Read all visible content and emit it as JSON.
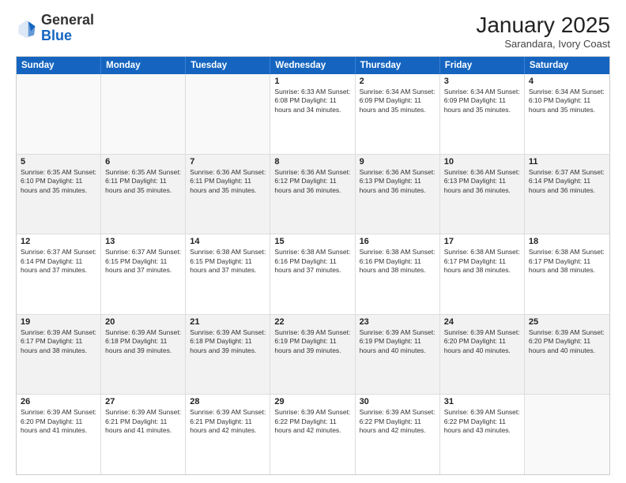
{
  "header": {
    "logo_general": "General",
    "logo_blue": "Blue",
    "month_title": "January 2025",
    "subtitle": "Sarandara, Ivory Coast"
  },
  "days_of_week": [
    "Sunday",
    "Monday",
    "Tuesday",
    "Wednesday",
    "Thursday",
    "Friday",
    "Saturday"
  ],
  "rows": [
    [
      {
        "day": "",
        "info": "",
        "empty": true
      },
      {
        "day": "",
        "info": "",
        "empty": true
      },
      {
        "day": "",
        "info": "",
        "empty": true
      },
      {
        "day": "1",
        "info": "Sunrise: 6:33 AM\nSunset: 6:08 PM\nDaylight: 11 hours and 34 minutes.",
        "empty": false
      },
      {
        "day": "2",
        "info": "Sunrise: 6:34 AM\nSunset: 6:09 PM\nDaylight: 11 hours and 35 minutes.",
        "empty": false
      },
      {
        "day": "3",
        "info": "Sunrise: 6:34 AM\nSunset: 6:09 PM\nDaylight: 11 hours and 35 minutes.",
        "empty": false
      },
      {
        "day": "4",
        "info": "Sunrise: 6:34 AM\nSunset: 6:10 PM\nDaylight: 11 hours and 35 minutes.",
        "empty": false
      }
    ],
    [
      {
        "day": "5",
        "info": "Sunrise: 6:35 AM\nSunset: 6:10 PM\nDaylight: 11 hours and 35 minutes.",
        "shade": true
      },
      {
        "day": "6",
        "info": "Sunrise: 6:35 AM\nSunset: 6:11 PM\nDaylight: 11 hours and 35 minutes.",
        "shade": true
      },
      {
        "day": "7",
        "info": "Sunrise: 6:36 AM\nSunset: 6:11 PM\nDaylight: 11 hours and 35 minutes.",
        "shade": true
      },
      {
        "day": "8",
        "info": "Sunrise: 6:36 AM\nSunset: 6:12 PM\nDaylight: 11 hours and 36 minutes.",
        "shade": true
      },
      {
        "day": "9",
        "info": "Sunrise: 6:36 AM\nSunset: 6:13 PM\nDaylight: 11 hours and 36 minutes.",
        "shade": true
      },
      {
        "day": "10",
        "info": "Sunrise: 6:36 AM\nSunset: 6:13 PM\nDaylight: 11 hours and 36 minutes.",
        "shade": true
      },
      {
        "day": "11",
        "info": "Sunrise: 6:37 AM\nSunset: 6:14 PM\nDaylight: 11 hours and 36 minutes.",
        "shade": true
      }
    ],
    [
      {
        "day": "12",
        "info": "Sunrise: 6:37 AM\nSunset: 6:14 PM\nDaylight: 11 hours and 37 minutes.",
        "empty": false
      },
      {
        "day": "13",
        "info": "Sunrise: 6:37 AM\nSunset: 6:15 PM\nDaylight: 11 hours and 37 minutes.",
        "empty": false
      },
      {
        "day": "14",
        "info": "Sunrise: 6:38 AM\nSunset: 6:15 PM\nDaylight: 11 hours and 37 minutes.",
        "empty": false
      },
      {
        "day": "15",
        "info": "Sunrise: 6:38 AM\nSunset: 6:16 PM\nDaylight: 11 hours and 37 minutes.",
        "empty": false
      },
      {
        "day": "16",
        "info": "Sunrise: 6:38 AM\nSunset: 6:16 PM\nDaylight: 11 hours and 38 minutes.",
        "empty": false
      },
      {
        "day": "17",
        "info": "Sunrise: 6:38 AM\nSunset: 6:17 PM\nDaylight: 11 hours and 38 minutes.",
        "empty": false
      },
      {
        "day": "18",
        "info": "Sunrise: 6:38 AM\nSunset: 6:17 PM\nDaylight: 11 hours and 38 minutes.",
        "empty": false
      }
    ],
    [
      {
        "day": "19",
        "info": "Sunrise: 6:39 AM\nSunset: 6:17 PM\nDaylight: 11 hours and 38 minutes.",
        "shade": true
      },
      {
        "day": "20",
        "info": "Sunrise: 6:39 AM\nSunset: 6:18 PM\nDaylight: 11 hours and 39 minutes.",
        "shade": true
      },
      {
        "day": "21",
        "info": "Sunrise: 6:39 AM\nSunset: 6:18 PM\nDaylight: 11 hours and 39 minutes.",
        "shade": true
      },
      {
        "day": "22",
        "info": "Sunrise: 6:39 AM\nSunset: 6:19 PM\nDaylight: 11 hours and 39 minutes.",
        "shade": true
      },
      {
        "day": "23",
        "info": "Sunrise: 6:39 AM\nSunset: 6:19 PM\nDaylight: 11 hours and 40 minutes.",
        "shade": true
      },
      {
        "day": "24",
        "info": "Sunrise: 6:39 AM\nSunset: 6:20 PM\nDaylight: 11 hours and 40 minutes.",
        "shade": true
      },
      {
        "day": "25",
        "info": "Sunrise: 6:39 AM\nSunset: 6:20 PM\nDaylight: 11 hours and 40 minutes.",
        "shade": true
      }
    ],
    [
      {
        "day": "26",
        "info": "Sunrise: 6:39 AM\nSunset: 6:20 PM\nDaylight: 11 hours and 41 minutes.",
        "empty": false
      },
      {
        "day": "27",
        "info": "Sunrise: 6:39 AM\nSunset: 6:21 PM\nDaylight: 11 hours and 41 minutes.",
        "empty": false
      },
      {
        "day": "28",
        "info": "Sunrise: 6:39 AM\nSunset: 6:21 PM\nDaylight: 11 hours and 42 minutes.",
        "empty": false
      },
      {
        "day": "29",
        "info": "Sunrise: 6:39 AM\nSunset: 6:22 PM\nDaylight: 11 hours and 42 minutes.",
        "empty": false
      },
      {
        "day": "30",
        "info": "Sunrise: 6:39 AM\nSunset: 6:22 PM\nDaylight: 11 hours and 42 minutes.",
        "empty": false
      },
      {
        "day": "31",
        "info": "Sunrise: 6:39 AM\nSunset: 6:22 PM\nDaylight: 11 hours and 43 minutes.",
        "empty": false
      },
      {
        "day": "",
        "info": "",
        "empty": true
      }
    ]
  ]
}
